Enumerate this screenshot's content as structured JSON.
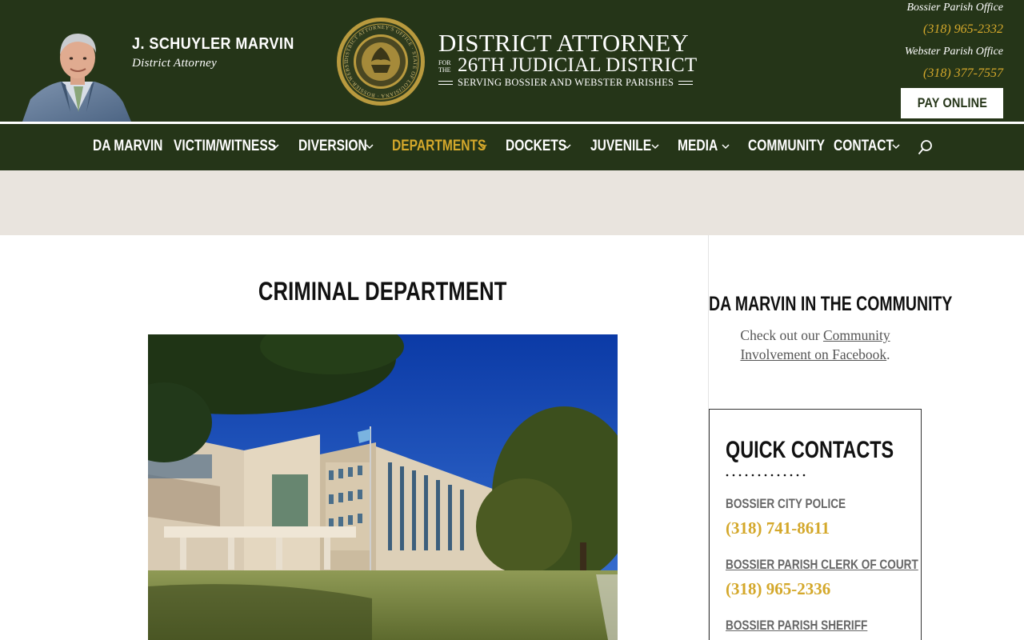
{
  "header": {
    "da_name": "J. SCHUYLER MARVIN",
    "da_title": "District Attorney",
    "logo": {
      "line1": "DISTRICT ATTORNEY",
      "for_the": "FOR THE",
      "line2": "26TH JUDICIAL DISTRICT",
      "line3": "SERVING BOSSIER AND WEBSTER PARISHES",
      "seal_text": "DISTRICT ATTORNEY'S OFFICE · STATE OF LOUISIANA · BOSSIER-WEBSTER PARISHES"
    },
    "offices": [
      {
        "name": "Bossier Parish Office",
        "phone": "(318) 965-2332"
      },
      {
        "name": "Webster Parish Office",
        "phone": "(318) 377-7557"
      }
    ],
    "pay_online": "PAY ONLINE"
  },
  "nav": {
    "items": [
      {
        "label": "DA MARVIN",
        "has_dropdown": false,
        "active": false
      },
      {
        "label": "VICTIM/WITNESS",
        "has_dropdown": true,
        "active": false
      },
      {
        "label": "DIVERSION",
        "has_dropdown": true,
        "active": false
      },
      {
        "label": "DEPARTMENTS",
        "has_dropdown": true,
        "active": true
      },
      {
        "label": "DOCKETS",
        "has_dropdown": true,
        "active": false
      },
      {
        "label": "JUVENILE",
        "has_dropdown": true,
        "active": false
      },
      {
        "label": "MEDIA",
        "has_dropdown": true,
        "active": false
      },
      {
        "label": "COMMUNITY",
        "has_dropdown": false,
        "active": false
      },
      {
        "label": "CONTACT",
        "has_dropdown": true,
        "active": false
      }
    ],
    "search_icon": "search-icon"
  },
  "main": {
    "title": "CRIMINAL DEPARTMENT",
    "image_subject": "courthouse building"
  },
  "sidebar": {
    "community": {
      "title": "DA MARVIN IN THE COMMUNITY",
      "text_before": "Check out our ",
      "link": "Community Involvement on Facebook",
      "text_after": "."
    },
    "quick_contacts": {
      "title": "QUICK CONTACTS",
      "items": [
        {
          "name": "BOSSIER CITY POLICE",
          "phone": "(318) 741-8611",
          "linked": false
        },
        {
          "name": "BOSSIER PARISH CLERK OF COURT",
          "phone": "(318) 965-2336",
          "linked": true
        },
        {
          "name": "BOSSIER PARISH SHERIFF",
          "phone": "",
          "linked": true
        }
      ]
    }
  },
  "colors": {
    "header_green": "#253518",
    "accent_gold": "#d4a82b",
    "banner_beige": "#e9e4de"
  }
}
